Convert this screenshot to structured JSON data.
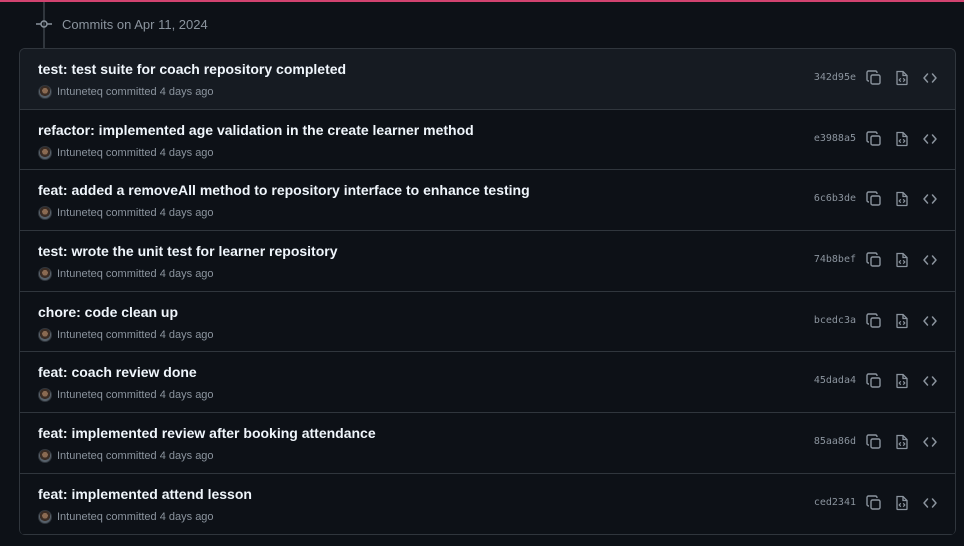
{
  "group_header": "Commits on Apr 11, 2024",
  "commits": [
    {
      "title": "test: test suite for coach repository completed",
      "meta": "Intuneteq committed 4 days ago",
      "sha": "342d95e"
    },
    {
      "title": "refactor: implemented age validation in the create learner method",
      "meta": "Intuneteq committed 4 days ago",
      "sha": "e3988a5"
    },
    {
      "title": "feat: added a removeAll method to repository interface to enhance testing",
      "meta": "Intuneteq committed 4 days ago",
      "sha": "6c6b3de"
    },
    {
      "title": "test: wrote the unit test for learner repository",
      "meta": "Intuneteq committed 4 days ago",
      "sha": "74b8bef"
    },
    {
      "title": "chore: code clean up",
      "meta": "Intuneteq committed 4 days ago",
      "sha": "bcedc3a"
    },
    {
      "title": "feat: coach review done",
      "meta": "Intuneteq committed 4 days ago",
      "sha": "45dada4"
    },
    {
      "title": "feat: implemented review after booking attendance",
      "meta": "Intuneteq committed 4 days ago",
      "sha": "85aa86d"
    },
    {
      "title": "feat: implemented attend lesson",
      "meta": "Intuneteq committed 4 days ago",
      "sha": "ced2341"
    }
  ],
  "icons": {
    "group": "git-commit-icon",
    "avatar": "user-avatar",
    "copy": "copy-icon",
    "browse": "file-code-icon",
    "code": "code-icon"
  },
  "colors": {
    "background": "#0d1117",
    "row_highlight": "#161b22",
    "border": "#30363d",
    "muted_text": "#8b949e",
    "title_text": "#f0f6fc",
    "top_accent": "#d1426f"
  }
}
